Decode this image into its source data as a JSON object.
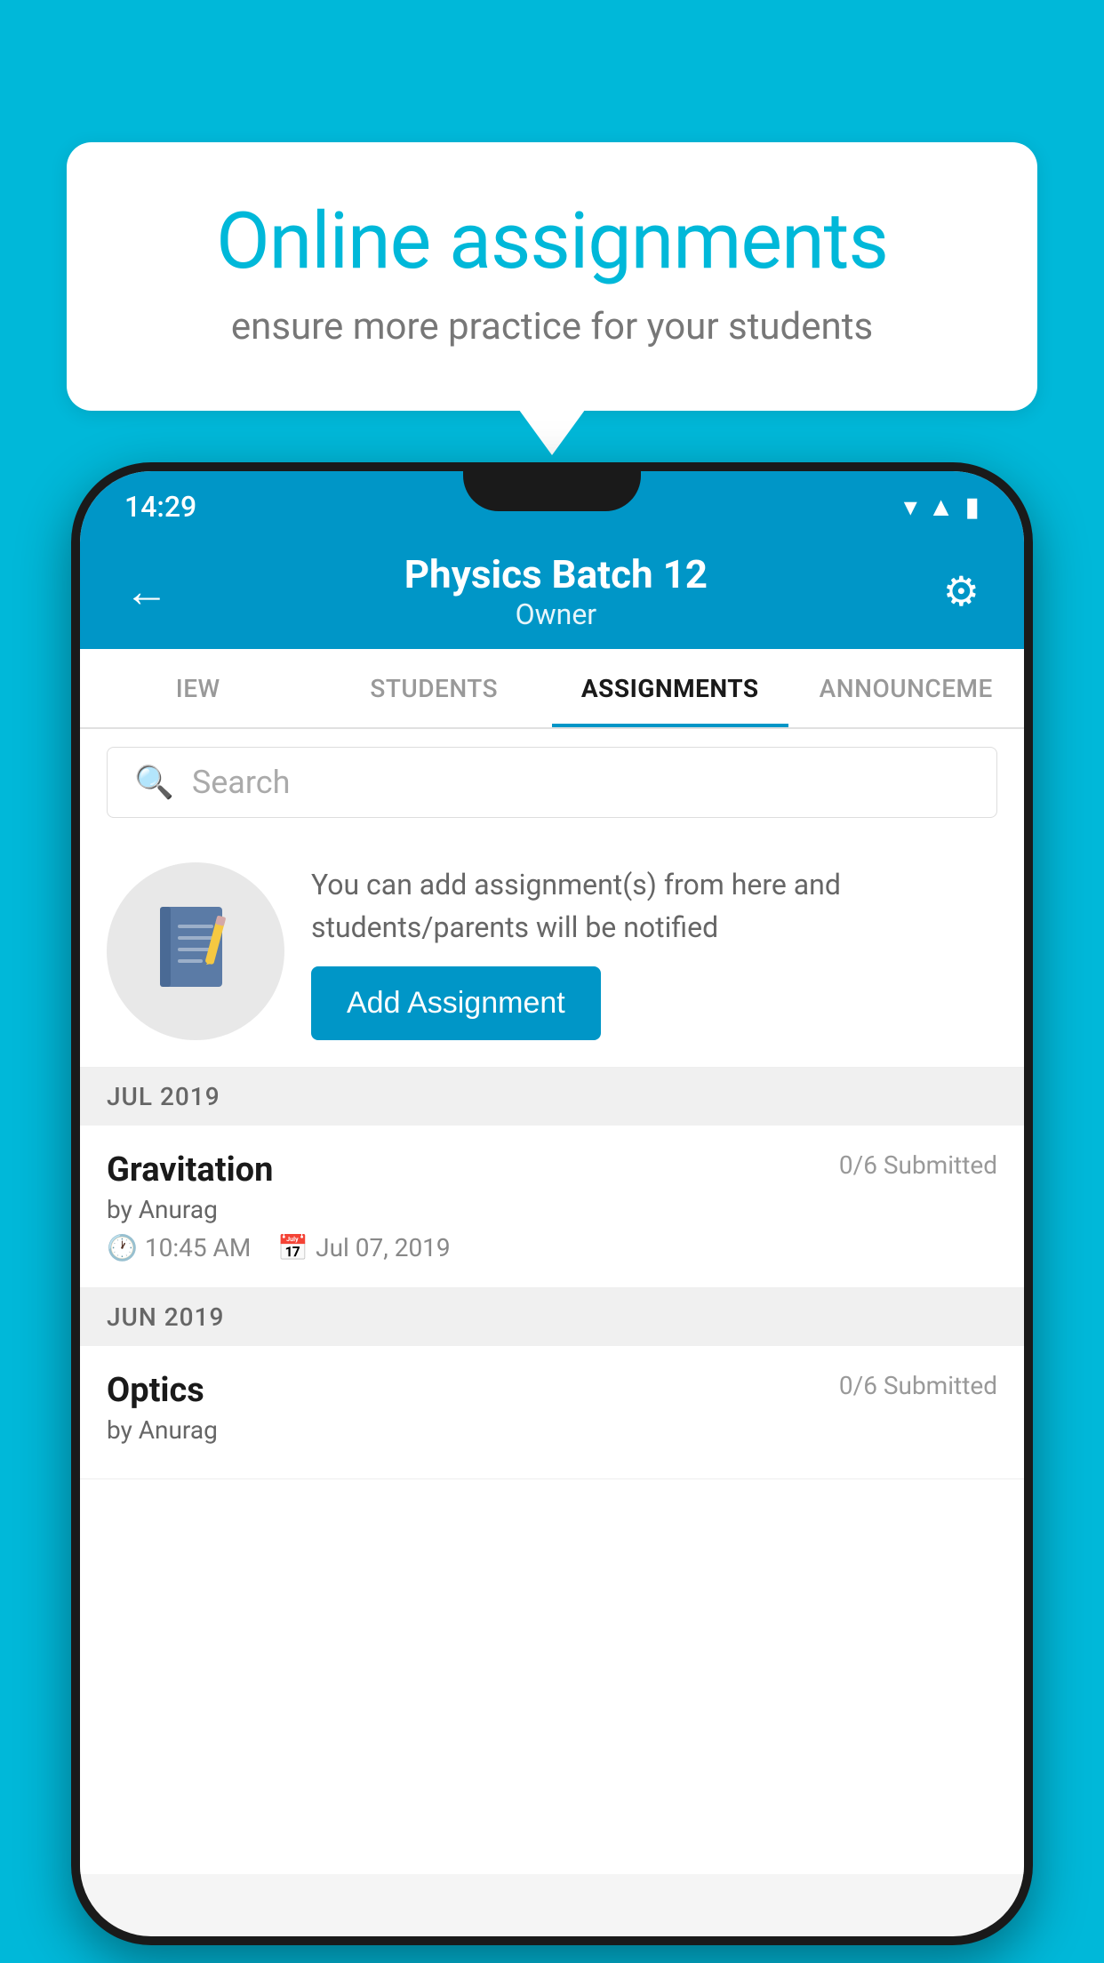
{
  "background_color": "#00b8d9",
  "speech_bubble": {
    "title": "Online assignments",
    "subtitle": "ensure more practice for your students"
  },
  "status_bar": {
    "time": "14:29",
    "icons": [
      "wifi",
      "signal",
      "battery"
    ]
  },
  "header": {
    "title": "Physics Batch 12",
    "subtitle": "Owner",
    "back_label": "←",
    "settings_label": "⚙"
  },
  "tabs": [
    {
      "label": "IEW",
      "active": false
    },
    {
      "label": "STUDENTS",
      "active": false
    },
    {
      "label": "ASSIGNMENTS",
      "active": true
    },
    {
      "label": "ANNOUNCEME",
      "active": false
    }
  ],
  "search": {
    "placeholder": "Search"
  },
  "promo": {
    "description": "You can add assignment(s) from here and students/parents will be notified",
    "button_label": "Add Assignment"
  },
  "sections": [
    {
      "label": "JUL 2019",
      "assignments": [
        {
          "name": "Gravitation",
          "submitted": "0/6 Submitted",
          "by": "by Anurag",
          "time": "10:45 AM",
          "date": "Jul 07, 2019"
        }
      ]
    },
    {
      "label": "JUN 2019",
      "assignments": [
        {
          "name": "Optics",
          "submitted": "0/6 Submitted",
          "by": "by Anurag",
          "time": "",
          "date": ""
        }
      ]
    }
  ]
}
